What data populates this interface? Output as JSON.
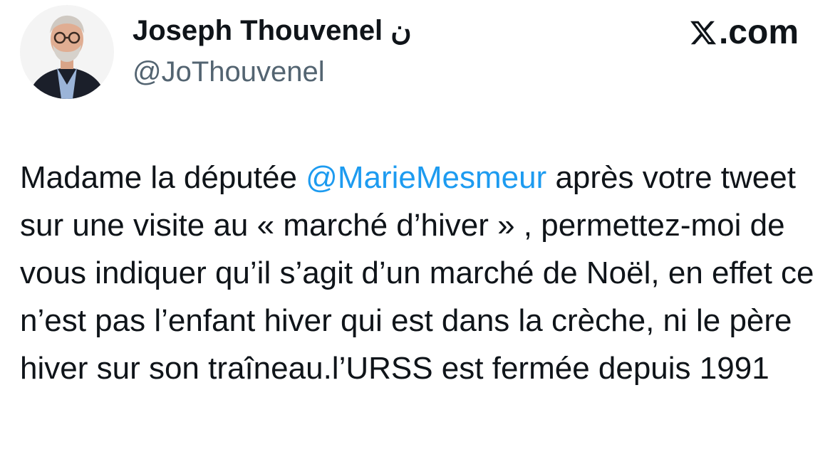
{
  "author": {
    "display_name": "Joseph Thouvenel ن",
    "handle": "@JoThouvenel"
  },
  "brand": {
    "label": ".com",
    "icon": "x-logo-icon"
  },
  "tweet": {
    "text_before": "Madame la députée ",
    "mention": "@MarieMesmeur",
    "text_after": " après votre tweet sur une visite au « marché d’hiver » , permettez-moi de vous indiquer qu’il s’agit d’un marché de Noël, en effet ce n’est pas l’enfant hiver qui est dans la crèche, ni le père hiver sur son traîneau.l’URSS est fermée depuis 1991"
  },
  "colors": {
    "text": "#0f1419",
    "secondary": "#536471",
    "link": "#1d9bf0",
    "background": "#ffffff"
  }
}
